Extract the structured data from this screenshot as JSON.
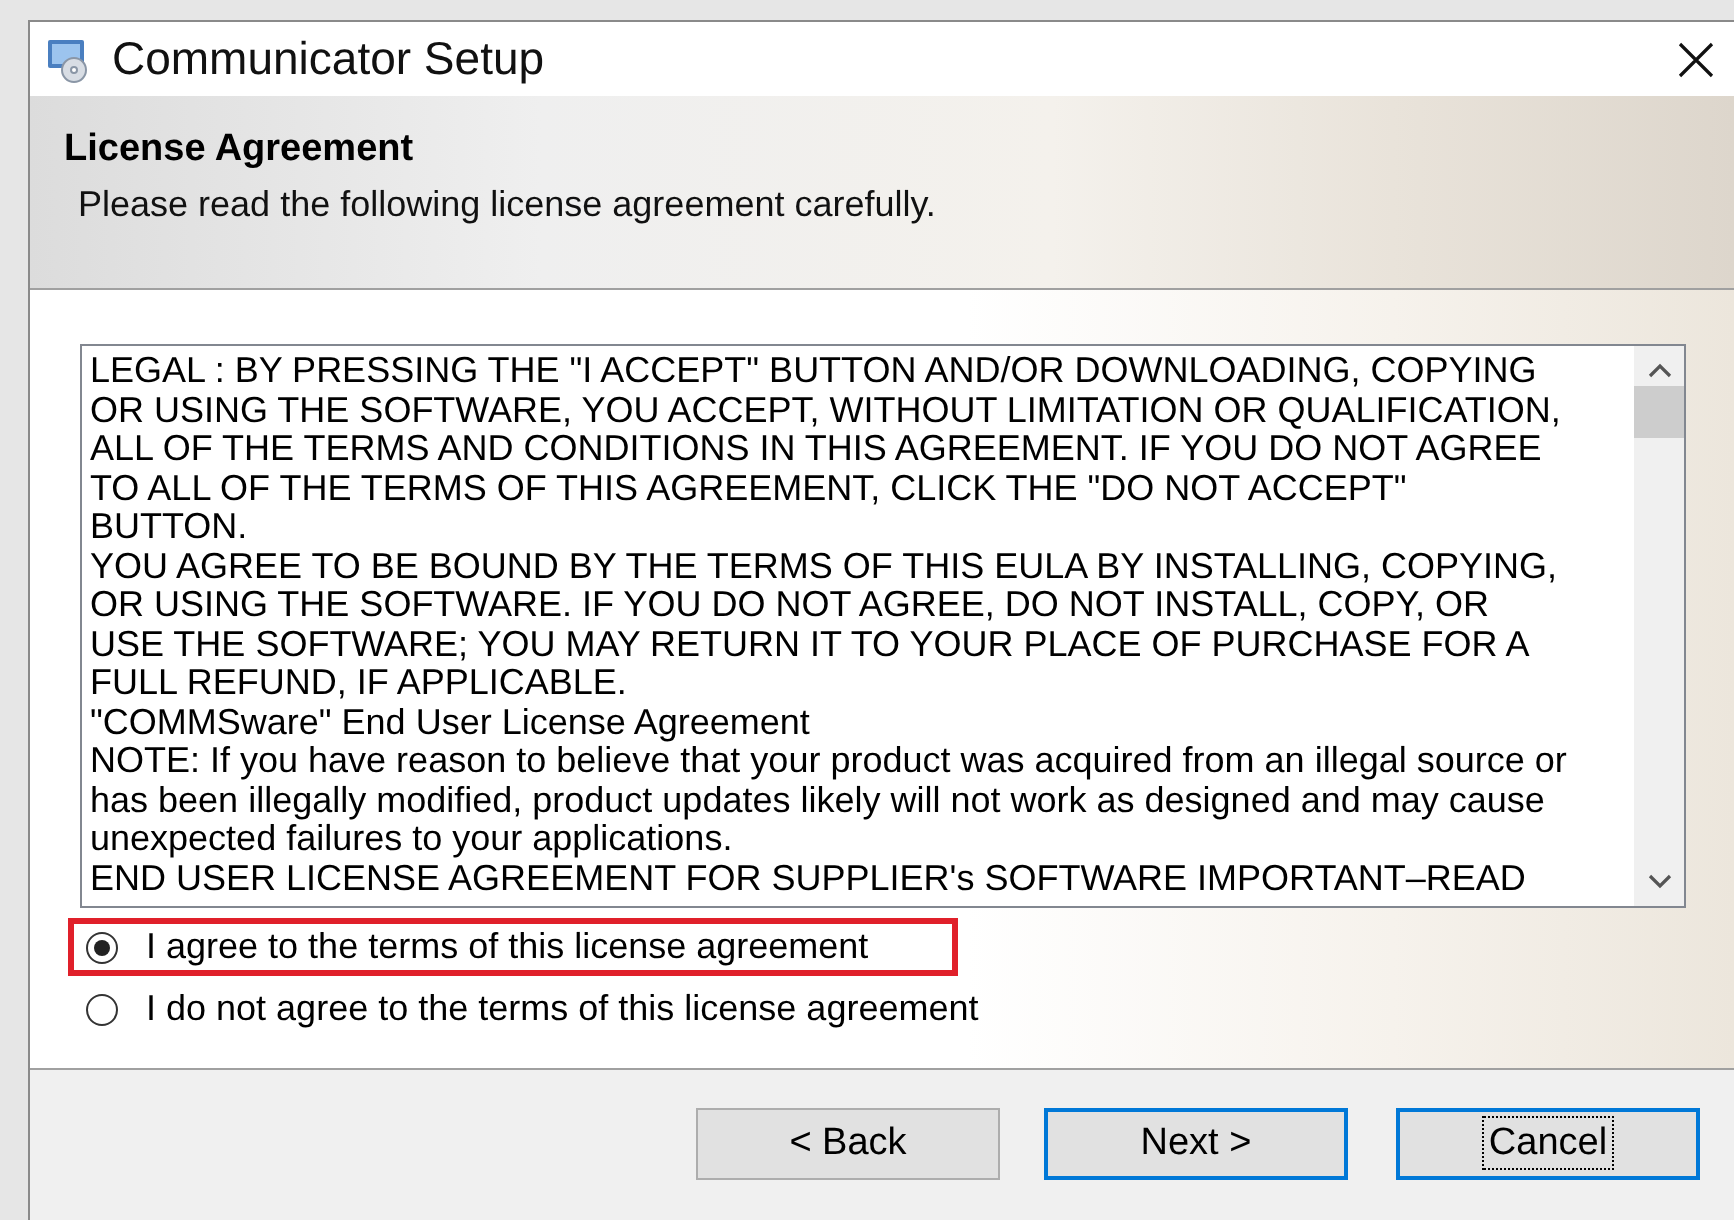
{
  "window": {
    "title": "Communicator Setup"
  },
  "header": {
    "title": "License Agreement",
    "subtitle": "Please read the following license agreement carefully."
  },
  "license_text": [
    "LEGAL : BY PRESSING THE \"I ACCEPT\" BUTTON AND/OR DOWNLOADING, COPYING\nOR USING THE SOFTWARE, YOU ACCEPT, WITHOUT LIMITATION OR QUALIFICATION,\nALL OF THE TERMS AND CONDITIONS IN THIS AGREEMENT. IF YOU DO NOT AGREE\nTO ALL OF THE TERMS OF THIS AGREEMENT, CLICK THE \"DO NOT ACCEPT\"\nBUTTON.",
    "YOU AGREE TO BE BOUND BY THE TERMS OF THIS EULA BY INSTALLING, COPYING,\nOR USING THE SOFTWARE. IF YOU DO NOT AGREE, DO NOT INSTALL, COPY, OR\nUSE THE SOFTWARE; YOU MAY RETURN IT TO YOUR PLACE OF PURCHASE FOR A\nFULL REFUND, IF APPLICABLE.",
    "\"COMMSware\" End User License Agreement",
    "NOTE: If you have reason to believe that your product was acquired from an illegal source or\nhas been illegally modified, product updates likely will not work as designed and may cause\nunexpected failures to your applications.",
    "END USER LICENSE AGREEMENT FOR SUPPLIER's SOFTWARE IMPORTANT–READ"
  ],
  "options": [
    {
      "label": "I agree to the terms of this license agreement",
      "selected": true,
      "highlighted": true
    },
    {
      "label": "I do not agree to the terms of this license agreement",
      "selected": false,
      "highlighted": false
    }
  ],
  "buttons": [
    {
      "label": "< Back",
      "default": false,
      "focused": false
    },
    {
      "label": "Next >",
      "default": true,
      "focused": false
    },
    {
      "label": "Cancel",
      "default": true,
      "focused": true
    }
  ]
}
